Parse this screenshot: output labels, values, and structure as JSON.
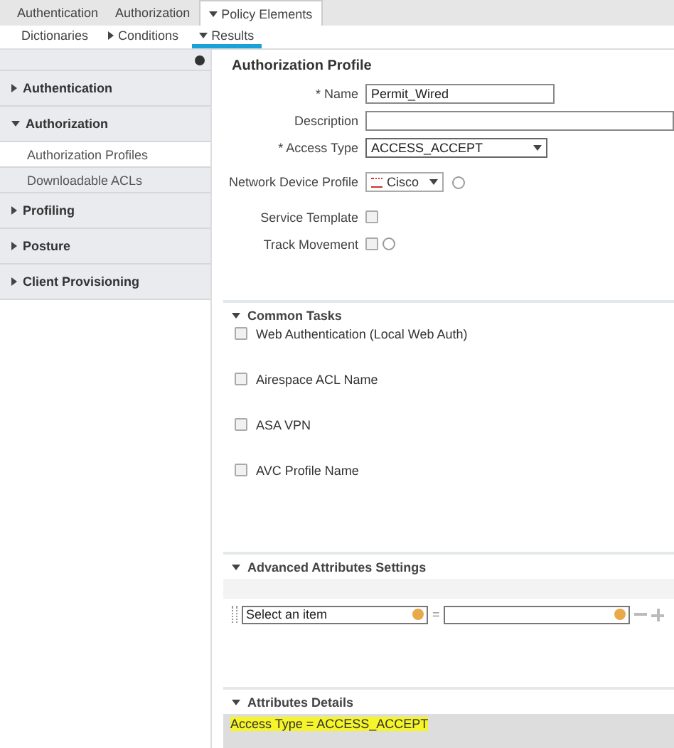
{
  "top_tabs": [
    {
      "label": "Authentication",
      "selected": false
    },
    {
      "label": "Authorization",
      "selected": false
    },
    {
      "label": "Policy Elements",
      "selected": true,
      "has_menu": true
    }
  ],
  "sub_tabs": [
    {
      "label": "Dictionaries",
      "selected": false
    },
    {
      "label": "Conditions",
      "selected": false,
      "expanded": false
    },
    {
      "label": "Results",
      "selected": true,
      "expanded": true
    }
  ],
  "sidebar": {
    "sections": [
      {
        "label": "Authentication",
        "expanded": false
      },
      {
        "label": "Authorization",
        "expanded": true,
        "children": [
          {
            "label": "Authorization Profiles",
            "selected": true
          },
          {
            "label": "Downloadable ACLs",
            "selected": false
          }
        ]
      },
      {
        "label": "Profiling",
        "expanded": false
      },
      {
        "label": "Posture",
        "expanded": false
      },
      {
        "label": "Client Provisioning",
        "expanded": false
      }
    ]
  },
  "profile": {
    "title": "Authorization Profile",
    "fields": [
      {
        "kind": "text",
        "label": "* Name",
        "value": "Permit_Wired"
      },
      {
        "kind": "wide",
        "label": "Description"
      },
      {
        "kind": "select",
        "label": "* Access Type",
        "value": "ACCESS_ACCEPT"
      },
      {
        "kind": "device",
        "label": "Network Device Profile",
        "value": "Cisco"
      },
      {
        "kind": "checkbox",
        "label": "Service Template",
        "checked": false
      },
      {
        "kind": "checkbox",
        "label": "Track Movement",
        "checked": false,
        "info": true
      }
    ]
  },
  "common_tasks": {
    "title": "Common Tasks",
    "expanded": true,
    "items": [
      {
        "label": "Web Authentication (Local Web Auth)",
        "checked": false
      },
      {
        "label": "Airespace ACL Name",
        "checked": false
      },
      {
        "label": "ASA VPN",
        "checked": false
      },
      {
        "label": "AVC Profile Name",
        "checked": false
      }
    ]
  },
  "advanced": {
    "title": "Advanced Attributes Settings",
    "expanded": true,
    "attribute_placeholder": "Select an item",
    "operator": "="
  },
  "details": {
    "title": "Attributes Details",
    "expanded": true,
    "lines": [
      {
        "text": "Access Type = ACCESS_ACCEPT",
        "highlighted": true
      }
    ]
  }
}
